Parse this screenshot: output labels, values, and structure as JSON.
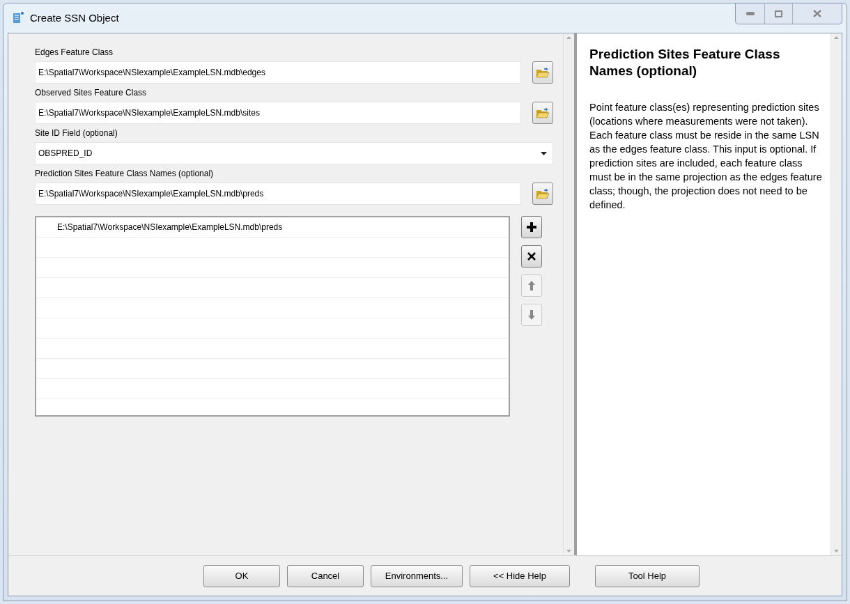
{
  "window": {
    "title": "Create SSN Object"
  },
  "fields": [
    {
      "kind": "text",
      "label": "Edges Feature Class",
      "value": "E:\\Spatial7\\Workspace\\NSIexample\\ExampleLSN.mdb\\edges"
    },
    {
      "kind": "text",
      "label": "Observed Sites Feature Class",
      "value": "E:\\Spatial7\\Workspace\\NSIexample\\ExampleLSN.mdb\\sites"
    },
    {
      "kind": "dropdown",
      "label": "Site ID Field (optional)",
      "value": "OBSPRED_ID"
    },
    {
      "kind": "text",
      "label": "Prediction Sites Feature Class Names (optional)",
      "value": "E:\\Spatial7\\Workspace\\NSIexample\\ExampleLSN.mdb\\preds"
    }
  ],
  "list": {
    "items": [
      "E:\\Spatial7\\Workspace\\NSIexample\\ExampleLSN.mdb\\preds"
    ],
    "tools": [
      {
        "kind": "add",
        "disabled": false
      },
      {
        "kind": "remove",
        "disabled": false
      },
      {
        "kind": "up",
        "disabled": true
      },
      {
        "kind": "down",
        "disabled": true
      }
    ]
  },
  "help": {
    "title": "Prediction Sites Feature Class Names (optional)",
    "body": "Point feature class(es) representing prediction sites (locations where measurements were not taken). Each feature class must be reside in the same LSN as the edges feature class. This input is optional. If prediction sites are included, each feature class must be in the same projection as the edges feature class; though, the projection does not need to be defined."
  },
  "buttons": [
    "OK",
    "Cancel",
    "Environments...",
    "<< Hide Help",
    "Tool Help"
  ]
}
